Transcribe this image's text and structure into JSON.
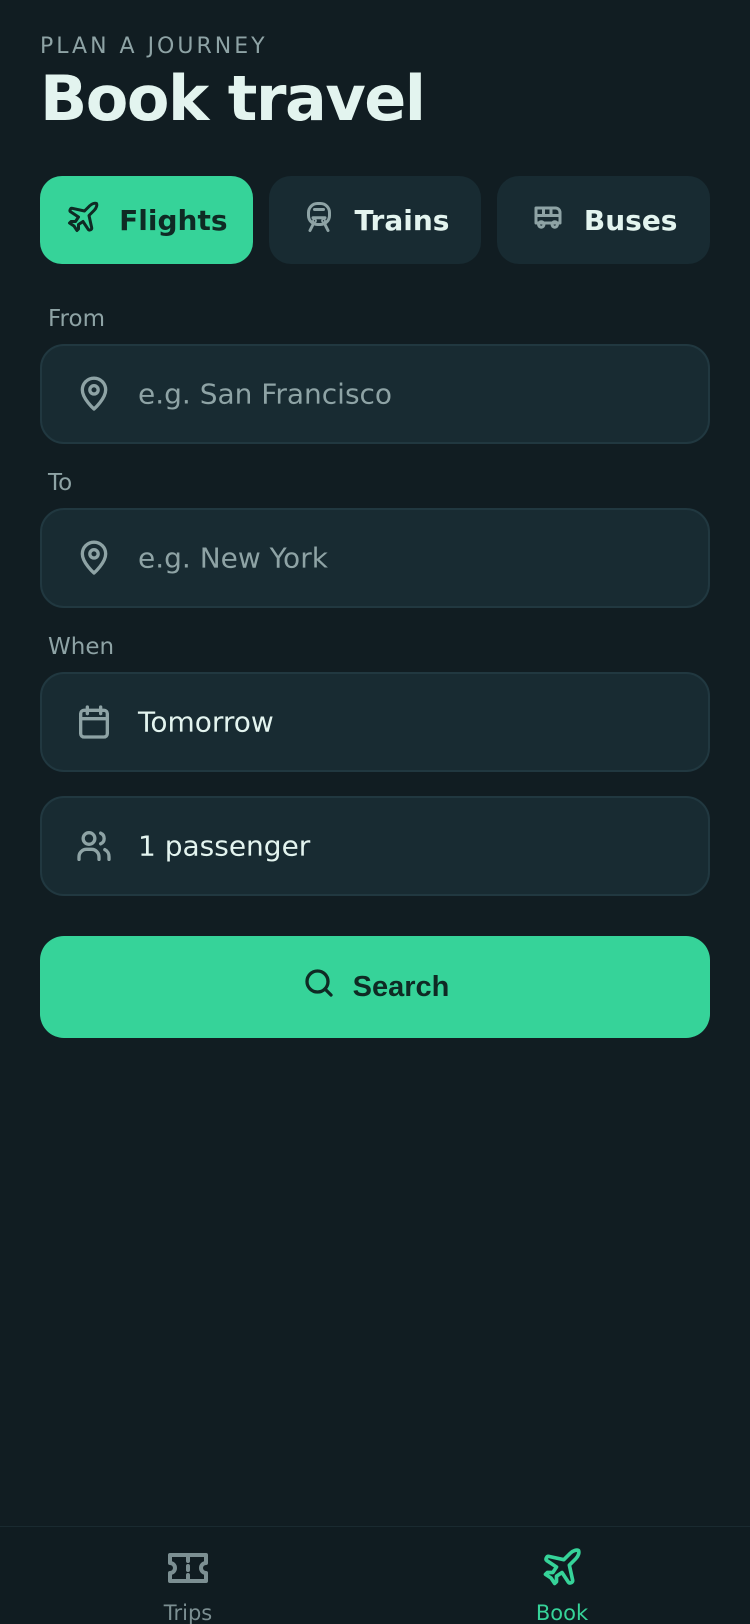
{
  "header": {
    "eyebrow": "PLAN A JOURNEY",
    "title": "Book travel"
  },
  "modes": [
    {
      "label": "Flights",
      "icon": "plane-icon",
      "active": true
    },
    {
      "label": "Trains",
      "icon": "train-icon",
      "active": false
    },
    {
      "label": "Buses",
      "icon": "bus-icon",
      "active": false
    }
  ],
  "form": {
    "from": {
      "label": "From",
      "placeholder": "e.g. San Francisco",
      "value": "",
      "icon": "map-pin-icon"
    },
    "to": {
      "label": "To",
      "placeholder": "e.g. New York",
      "value": "",
      "icon": "map-pin-icon"
    },
    "when": {
      "label": "When",
      "value": "Tomorrow",
      "icon": "calendar-icon"
    },
    "passengers": {
      "value": "1 passenger",
      "icon": "users-icon"
    }
  },
  "search": {
    "label": "Search",
    "icon": "search-icon"
  },
  "tabbar": [
    {
      "label": "Trips",
      "icon": "ticket-icon",
      "active": false
    },
    {
      "label": "Book",
      "icon": "plane-icon",
      "active": true
    }
  ],
  "colors": {
    "background": "#111d22",
    "accent": "#36d399",
    "surface": "#182b32",
    "muted_text": "#8ea3a5"
  }
}
